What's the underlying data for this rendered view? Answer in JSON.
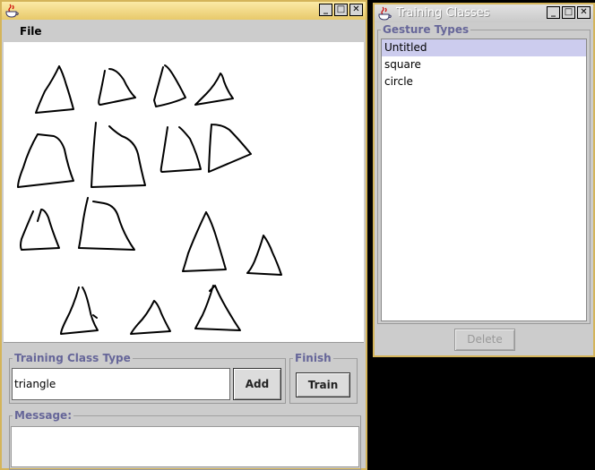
{
  "main_window": {
    "icon": "java-cup-icon",
    "menu": {
      "file_label": "File"
    },
    "training_class_type": {
      "legend": "Training Class Type",
      "input_value": "triangle",
      "add_label": "Add"
    },
    "finish": {
      "legend": "Finish",
      "train_label": "Train"
    },
    "message": {
      "legend": "Message:",
      "text": ""
    }
  },
  "training_window": {
    "icon": "java-cup-icon",
    "title": "Training Classes",
    "list_legend": "Gesture Types",
    "items": [
      {
        "label": "Untitled",
        "selected": true
      },
      {
        "label": "square",
        "selected": false
      },
      {
        "label": "circle",
        "selected": false
      }
    ],
    "delete_label": "Delete"
  },
  "colors": {
    "title_gradient_active": "#e8c96a",
    "window_bg": "#cccccc",
    "legend_text": "#666699",
    "selection": "#ccccee",
    "desktop": "#000000"
  }
}
